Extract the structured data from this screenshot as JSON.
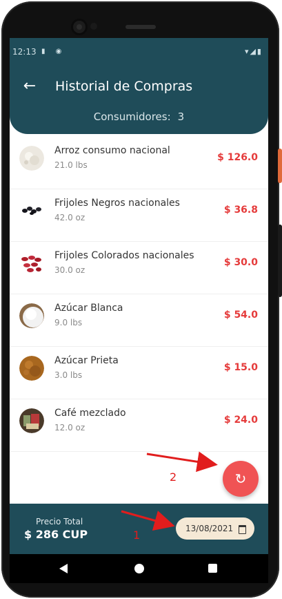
{
  "status_bar": {
    "time": "12:13",
    "left_icons": "▮ ◉",
    "right_icons": "▾◢▮"
  },
  "app_bar": {
    "back_icon": "←",
    "title": "Historial de Compras",
    "consumers_label": "Consumidores:",
    "consumers_count": "3"
  },
  "items": [
    {
      "name": "Arroz consumo nacional",
      "qty": "21.0 lbs",
      "price": "$ 126.0",
      "thumb": "rice"
    },
    {
      "name": "Frijoles Negros nacionales",
      "qty": "42.0 oz",
      "price": "$ 36.8",
      "thumb": "black-beans"
    },
    {
      "name": "Frijoles Colorados nacionales",
      "qty": "30.0 oz",
      "price": "$ 30.0",
      "thumb": "red-beans"
    },
    {
      "name": "Azúcar Blanca",
      "qty": "9.0 lbs",
      "price": "$ 54.0",
      "thumb": "white-sugar"
    },
    {
      "name": "Azúcar Prieta",
      "qty": "3.0 lbs",
      "price": "$ 15.0",
      "thumb": "brown-sugar"
    },
    {
      "name": "Café mezclado",
      "qty": "12.0 oz",
      "price": "$ 24.0",
      "thumb": "coffee"
    }
  ],
  "fab": {
    "icon": "↻"
  },
  "bottom_bar": {
    "total_label": "Precio Total",
    "total_value": "$ 286 CUP",
    "date": "13/08/2021"
  },
  "annotations": {
    "label_1": "1",
    "label_2": "2"
  },
  "colors": {
    "primary": "#1f4c59",
    "accent": "#f05354",
    "price": "#e53b3b",
    "date_chip": "#f5e9d6"
  }
}
